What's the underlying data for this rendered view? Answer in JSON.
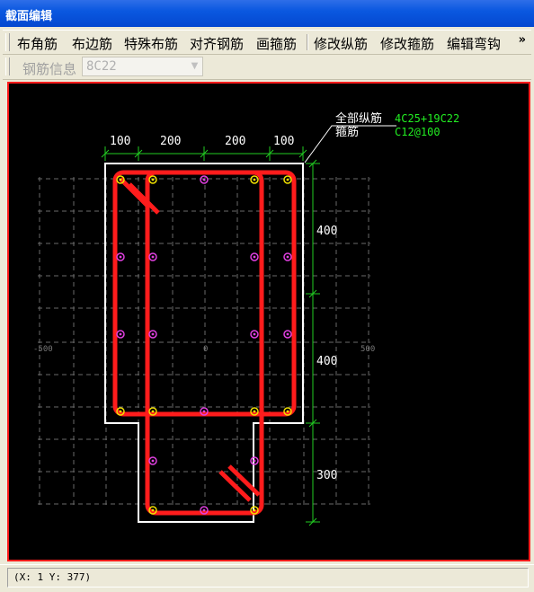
{
  "window": {
    "title": "截面编辑"
  },
  "toolbar": {
    "buttons": [
      "布角筋",
      "布边筋",
      "特殊布筋",
      "对齐钢筋",
      "画箍筋",
      "修改纵筋",
      "修改箍筋",
      "编辑弯钩"
    ],
    "more": "»"
  },
  "rebar_info": {
    "label": "钢筋信息",
    "value": "8C22"
  },
  "drawing": {
    "all_longitudinal_label": "全部纵筋",
    "all_longitudinal_value": "4C25+19C22",
    "stirrup_label": "箍筋",
    "stirrup_value": "C12@100",
    "top_dimensions": [
      "100",
      "200",
      "200",
      "100"
    ],
    "side_dimensions": [
      "400",
      "400",
      "300"
    ],
    "axis_labels": {
      "left": "-500",
      "right": "500",
      "origin": "0"
    },
    "colors": {
      "background": "#000000",
      "outline": "#ffffff",
      "stirrup": "#ff1c1c",
      "dimension": "#22cc22",
      "corner_bar": "#f0e000",
      "side_bar": "#e040e0",
      "grid": "#6a6a6a"
    }
  },
  "status": {
    "coords": "(X: 1 Y: 377)"
  }
}
